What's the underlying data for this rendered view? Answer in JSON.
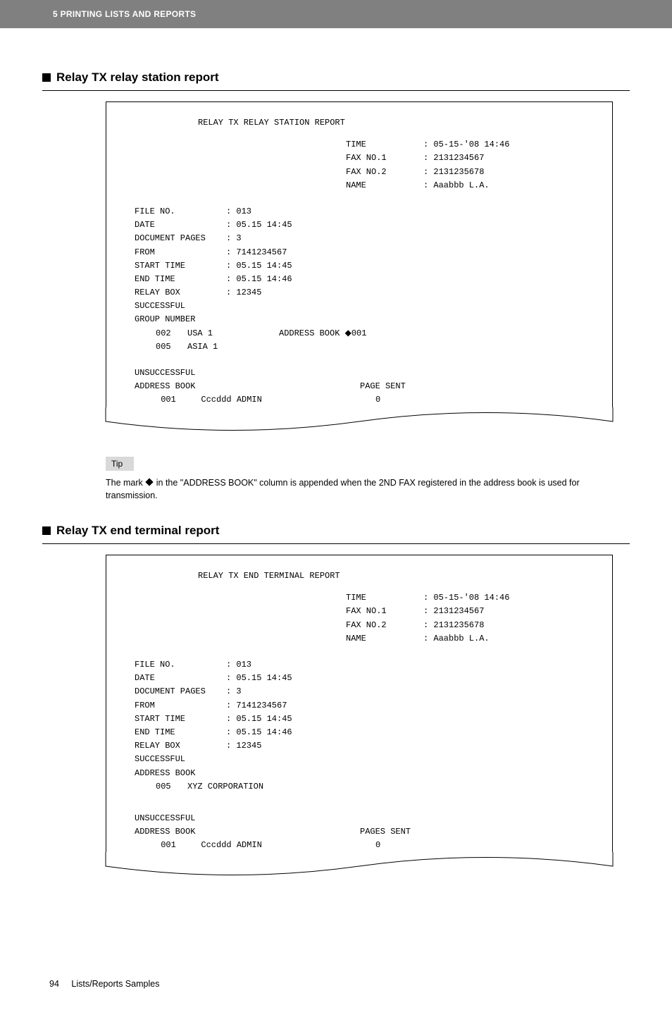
{
  "topbar": "5 PRINTING LISTS AND REPORTS",
  "section1": {
    "title": "Relay TX relay station report",
    "report_title": "RELAY TX RELAY STATION REPORT",
    "hdr": {
      "time_l": "TIME",
      "time_v": ": 05-15-'08 14:46",
      "f1_l": "FAX NO.1",
      "f1_v": ": 2131234567",
      "f2_l": "FAX NO.2",
      "f2_v": ": 2131235678",
      "name_l": "NAME",
      "name_v": ": Aaabbb L.A."
    },
    "meta": {
      "file_l": "FILE NO.",
      "file_v": ": 013",
      "date_l": "DATE",
      "date_v": ": 05.15 14:45",
      "dp_l": "DOCUMENT PAGES",
      "dp_v": ": 3",
      "from_l": "FROM",
      "from_v": ": 7141234567",
      "st_l": "START TIME",
      "st_v": ": 05.15 14:45",
      "et_l": "END TIME",
      "et_v": ": 05.15 14:46",
      "rb_l": "RELAY BOX",
      "rb_v": ": 12345",
      "succ": "SUCCESSFUL",
      "gn": "GROUP NUMBER",
      "g1_n": "002",
      "g1_name": "USA 1",
      "g1_ab": "ADDRESS BOOK ◆001",
      "g2_n": "005",
      "g2_name": "ASIA 1"
    },
    "uns": {
      "title": "UNSUCCESSFUL",
      "ab": "ADDRESS BOOK",
      "ps": "PAGE SENT",
      "r1_n": "001",
      "r1_name": "Cccddd ADMIN",
      "r1_p": "0"
    }
  },
  "tip": {
    "label": "Tip",
    "pre": "The mark ",
    "post": " in the \"ADDRESS BOOK\" column is appended when the 2ND FAX registered in the address book is used for transmission."
  },
  "section2": {
    "title": "Relay TX end terminal report",
    "report_title": "RELAY TX END TERMINAL REPORT",
    "hdr": {
      "time_l": "TIME",
      "time_v": ": 05-15-'08 14:46",
      "f1_l": "FAX NO.1",
      "f1_v": ": 2131234567",
      "f2_l": "FAX NO.2",
      "f2_v": ": 2131235678",
      "name_l": "NAME",
      "name_v": ": Aaabbb L.A."
    },
    "meta": {
      "file_l": "FILE NO.",
      "file_v": ": 013",
      "date_l": "DATE",
      "date_v": ": 05.15 14:45",
      "dp_l": "DOCUMENT PAGES",
      "dp_v": ": 3",
      "from_l": "FROM",
      "from_v": ": 7141234567",
      "st_l": "START TIME",
      "st_v": ": 05.15 14:45",
      "et_l": "END TIME",
      "et_v": ": 05.15 14:46",
      "rb_l": "RELAY BOX",
      "rb_v": ": 12345",
      "succ": "SUCCESSFUL",
      "ab": "ADDRESS BOOK",
      "r1_n": "005",
      "r1_name": "XYZ CORPORATION"
    },
    "uns": {
      "title": "UNSUCCESSFUL",
      "ab": "ADDRESS BOOK",
      "ps": "PAGES SENT",
      "r1_n": "001",
      "r1_name": "Cccddd ADMIN",
      "r1_p": "0"
    }
  },
  "footer": {
    "page": "94",
    "label": "Lists/Reports Samples"
  }
}
